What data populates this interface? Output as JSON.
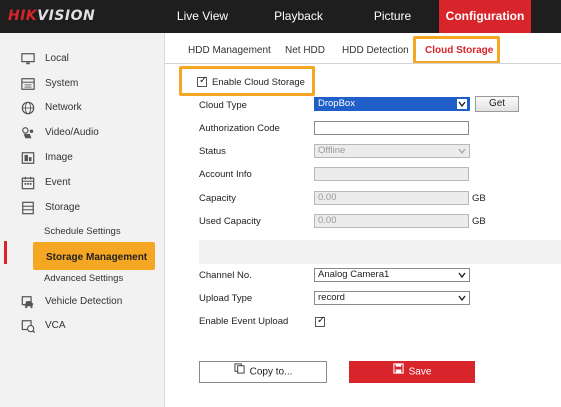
{
  "brand": {
    "logo_red": "HIK",
    "logo_rest": "VISION"
  },
  "nav": {
    "tabs": [
      {
        "label": "Live View"
      },
      {
        "label": "Playback"
      },
      {
        "label": "Picture"
      },
      {
        "label": "Configuration",
        "active": true
      }
    ]
  },
  "sidebar": {
    "items": [
      {
        "label": "Local",
        "icon": "monitor-icon"
      },
      {
        "label": "System",
        "icon": "system-icon"
      },
      {
        "label": "Network",
        "icon": "globe-icon"
      },
      {
        "label": "Video/Audio",
        "icon": "video-icon"
      },
      {
        "label": "Image",
        "icon": "image-icon"
      },
      {
        "label": "Event",
        "icon": "calendar-icon"
      },
      {
        "label": "Storage",
        "icon": "storage-icon"
      }
    ],
    "storage_sub": {
      "schedule": "Schedule Settings",
      "management": "Storage Management",
      "advanced": "Advanced Settings"
    },
    "bottom_items": [
      {
        "label": "Vehicle Detection",
        "icon": "vehicle-icon"
      },
      {
        "label": "VCA",
        "icon": "vca-icon"
      }
    ]
  },
  "subtabs": [
    {
      "label": "HDD Management"
    },
    {
      "label": "Net HDD"
    },
    {
      "label": "HDD Detection"
    },
    {
      "label": "Cloud Storage",
      "active": true
    }
  ],
  "form": {
    "enable_cloud_label": "Enable Cloud Storage",
    "enable_cloud_checked": true,
    "cloud_type": {
      "label": "Cloud Type",
      "value": "DropBox"
    },
    "get_button": "Get",
    "authorization_code": {
      "label": "Authorization Code",
      "value": ""
    },
    "status": {
      "label": "Status",
      "value": "Offline"
    },
    "account_info": {
      "label": "Account Info",
      "value": ""
    },
    "capacity": {
      "label": "Capacity",
      "value": "0.00",
      "unit": "GB"
    },
    "used_capacity": {
      "label": "Used Capacity",
      "value": "0.00",
      "unit": "GB"
    },
    "channel_no": {
      "label": "Channel No.",
      "value": "Analog Camera1"
    },
    "upload_type": {
      "label": "Upload Type",
      "value": "record"
    },
    "enable_event_upload": {
      "label": "Enable Event Upload",
      "checked": true
    }
  },
  "buttons": {
    "copy": "Copy to...",
    "save": "Save"
  },
  "colors": {
    "accent": "#d8242b",
    "highlight": "#f5a623",
    "select_blue": "#1f5fc7"
  }
}
